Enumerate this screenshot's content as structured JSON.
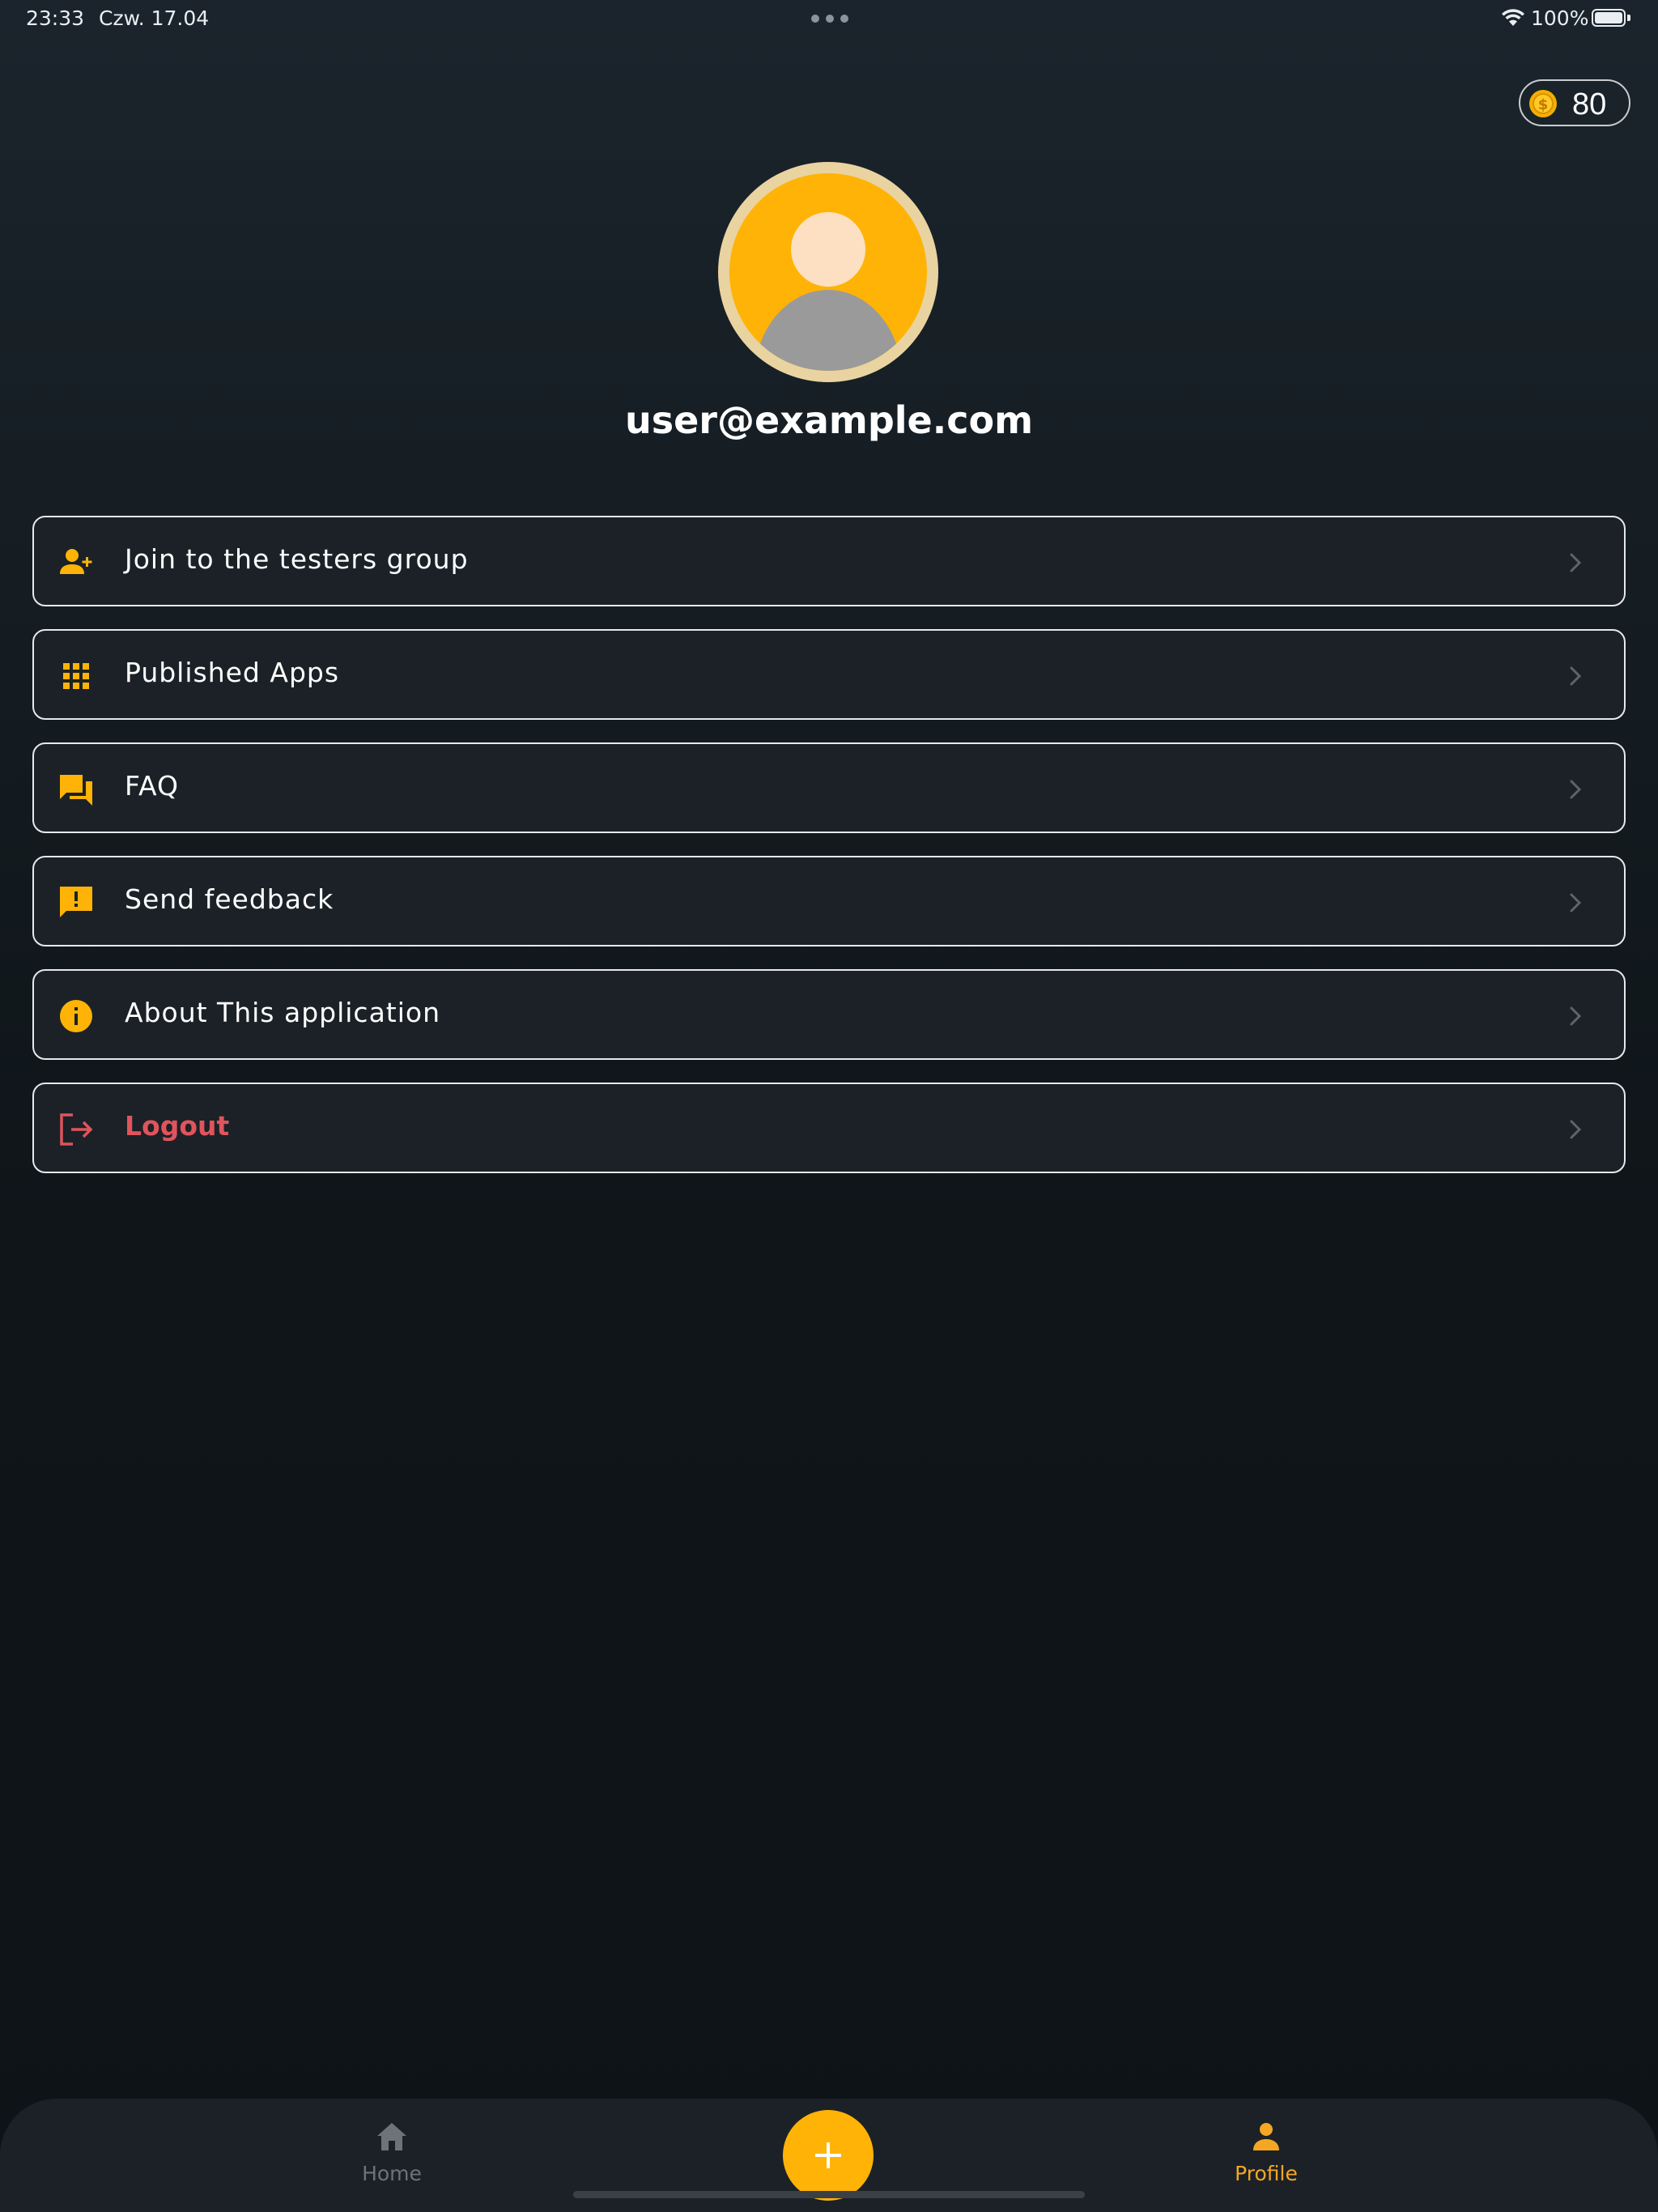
{
  "status_bar": {
    "time": "23:33",
    "date": "Czw. 17.04",
    "battery_percent": "100%",
    "wifi_icon": "wifi-icon",
    "battery_icon": "battery-full-icon"
  },
  "coins": {
    "icon": "coin-icon",
    "value": "80"
  },
  "profile": {
    "avatar_icon": "avatar-placeholder-icon",
    "email": "user@example.com"
  },
  "menu": {
    "items": [
      {
        "label": "Join to the testers group",
        "icon": "person-add-icon"
      },
      {
        "label": "Published Apps",
        "icon": "apps-grid-icon"
      },
      {
        "label": "FAQ",
        "icon": "forum-icon"
      },
      {
        "label": "Send feedback",
        "icon": "feedback-icon"
      },
      {
        "label": "About This application",
        "icon": "info-icon"
      },
      {
        "label": "Logout",
        "icon": "logout-icon"
      }
    ]
  },
  "bottom_nav": {
    "home_label": "Home",
    "profile_label": "Profile",
    "fab_icon": "plus-icon",
    "active": "Profile"
  },
  "colors": {
    "accent": "#ffb307",
    "danger": "#e0545c",
    "background": "#0f1519",
    "card": "#1b2127"
  }
}
